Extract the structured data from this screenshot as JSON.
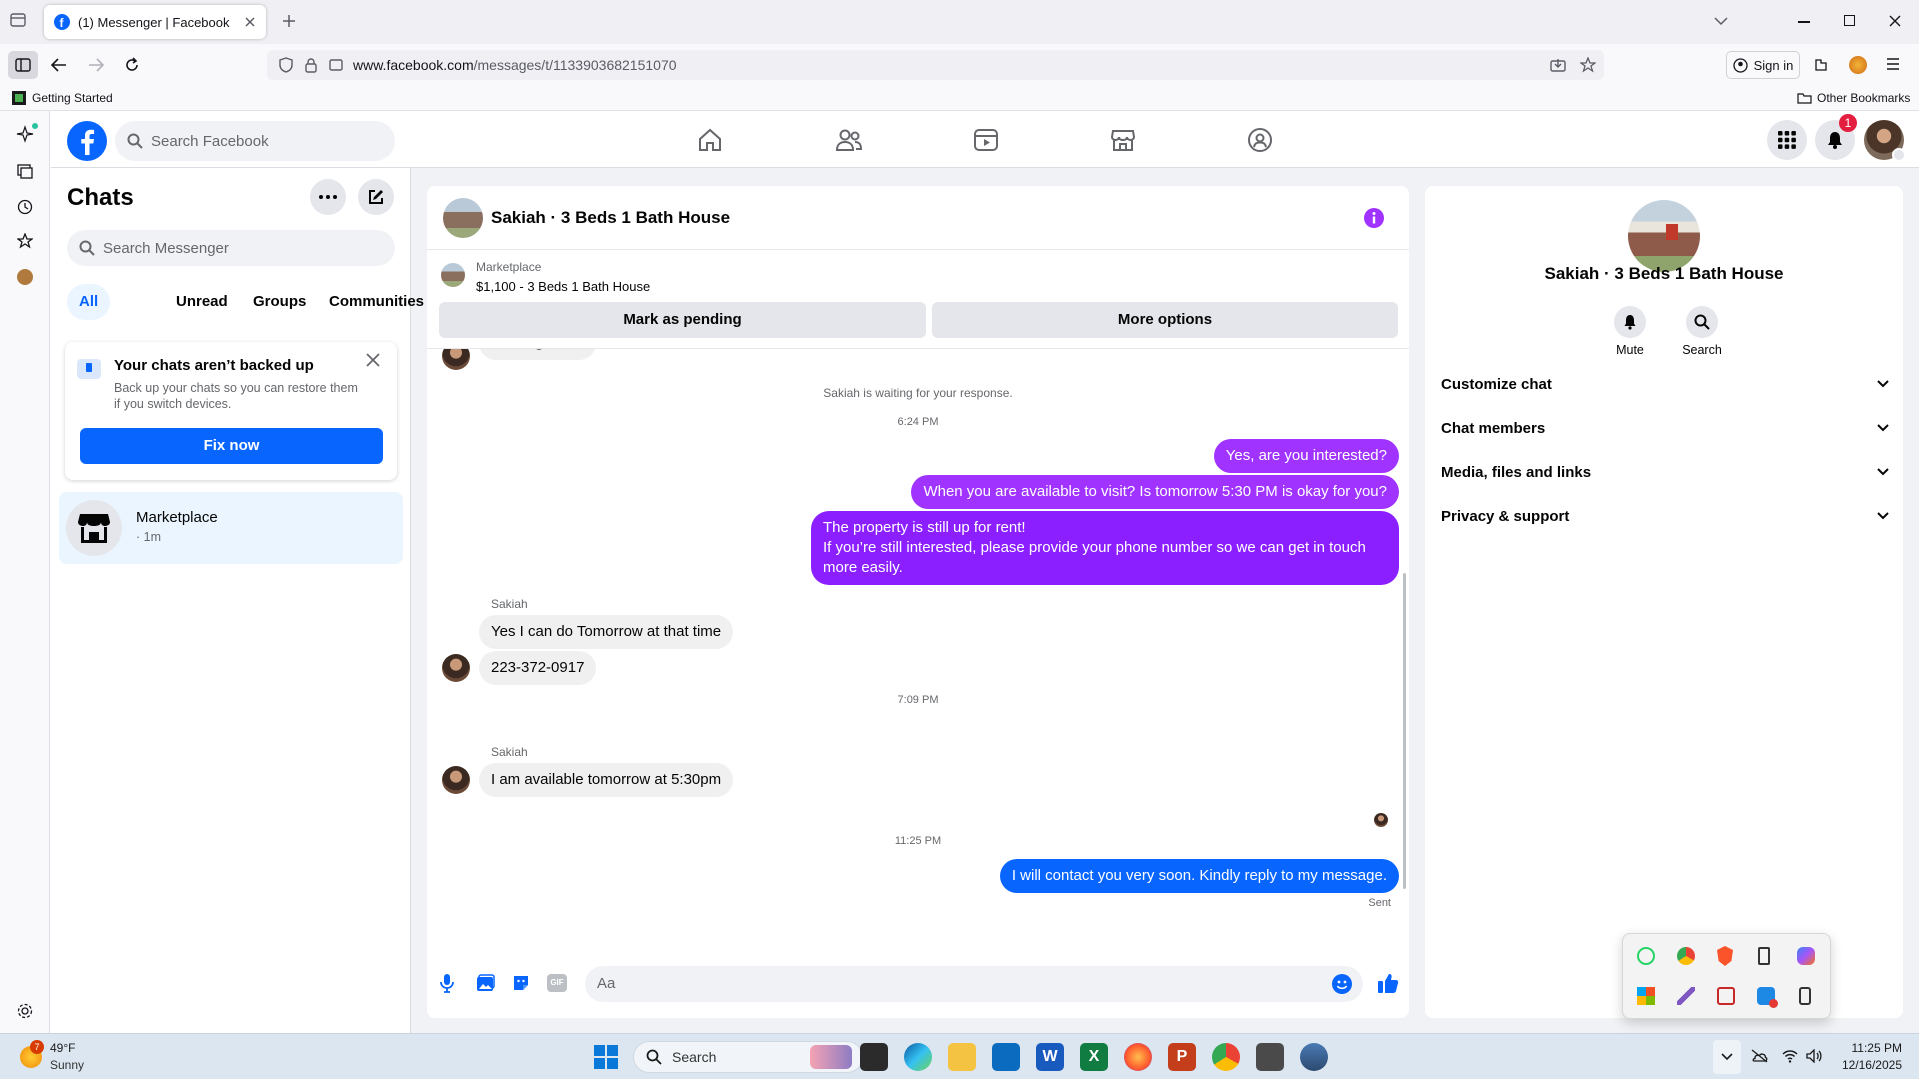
{
  "browser": {
    "tab_title": "(1) Messenger | Facebook",
    "url_host": "www.facebook.com",
    "url_path": "/messages/t/1133903682151070",
    "sign_in": "Sign in",
    "bookmark_getting_started": "Getting Started",
    "bookmark_other": "Other Bookmarks"
  },
  "fb_header": {
    "search_placeholder": "Search Facebook",
    "notification_count": "1"
  },
  "chats": {
    "title": "Chats",
    "search_placeholder": "Search Messenger",
    "filters": [
      "All",
      "Unread",
      "Groups",
      "Communities"
    ],
    "backup_title": "Your chats aren’t backed up",
    "backup_body": "Back up your chats so you can restore them if you switch devices.",
    "backup_button": "Fix now",
    "items": [
      {
        "name": "Marketplace",
        "meta": "· 1m"
      }
    ]
  },
  "thread": {
    "title": "Sakiah · 3 Beds 1 Bath House",
    "marketplace_label": "Marketplace",
    "listing": "$1,100 - 3 Beds 1 Bath House",
    "mark_pending": "Mark as pending",
    "more_options": "More options",
    "cut_message": "Message sent",
    "waiting": "Sakiah is waiting for your response.",
    "time1": "6:24 PM",
    "out1": "Yes, are you interested?",
    "out2": "When you are available to visit? Is tomorrow 5:30 PM is okay for you?",
    "out3_line1": "The property is still up for rent!",
    "out3_line2": "If you’re still interested, please provide your phone number so we can get in touch",
    "out3_line3": "more easily.",
    "sender1": "Sakiah",
    "in1": "Yes I can do Tomorrow at that time",
    "in2": "223-372-0917",
    "time2": "7:09 PM",
    "sender2": "Sakiah",
    "in3": "I am available tomorrow at 5:30pm",
    "time3": "11:25 PM",
    "out4": "I will contact you very soon. Kindly reply to my message.",
    "sent_status": "Sent",
    "composer_placeholder": "Aa"
  },
  "info_panel": {
    "name": "Sakiah · 3 Beds 1 Bath House",
    "mute": "Mute",
    "search": "Search",
    "sections": [
      "Customize chat",
      "Chat members",
      "Media, files and links",
      "Privacy & support"
    ]
  },
  "taskbar": {
    "weather_badge": "7",
    "temp": "49°F",
    "condition": "Sunny",
    "search": "Search",
    "time": "11:25 PM",
    "date": "12/16/2025"
  },
  "colors": {
    "fb_blue": "#0866ff",
    "accent_purple": "#a033ff"
  }
}
